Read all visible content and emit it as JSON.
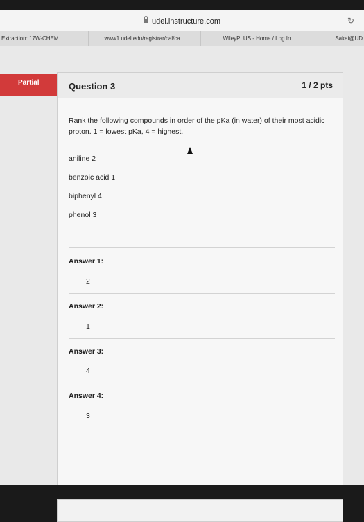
{
  "browser": {
    "url": "udel.instructure.com",
    "tabs": [
      {
        "label": "Extraction: 17W-CHEM..."
      },
      {
        "label": "www1.udel.edu/registrar/cal/ca..."
      },
      {
        "label": "WileyPLUS - Home / Log In"
      },
      {
        "label": "Sakai@UD"
      }
    ]
  },
  "question": {
    "status": "Partial",
    "title": "Question 3",
    "points": "1 / 2 pts",
    "prompt": "Rank the following compounds in order of the pKa (in water) of their most acidic proton. 1 = lowest pKa, 4 = highest.",
    "compounds": [
      "aniline 2",
      "benzoic acid 1",
      "biphenyl  4",
      "phenol 3"
    ],
    "answers": [
      {
        "label": "Answer 1:",
        "value": "2"
      },
      {
        "label": "Answer 2:",
        "value": "1"
      },
      {
        "label": "Answer 3:",
        "value": "4"
      },
      {
        "label": "Answer 4:",
        "value": "3"
      }
    ]
  }
}
